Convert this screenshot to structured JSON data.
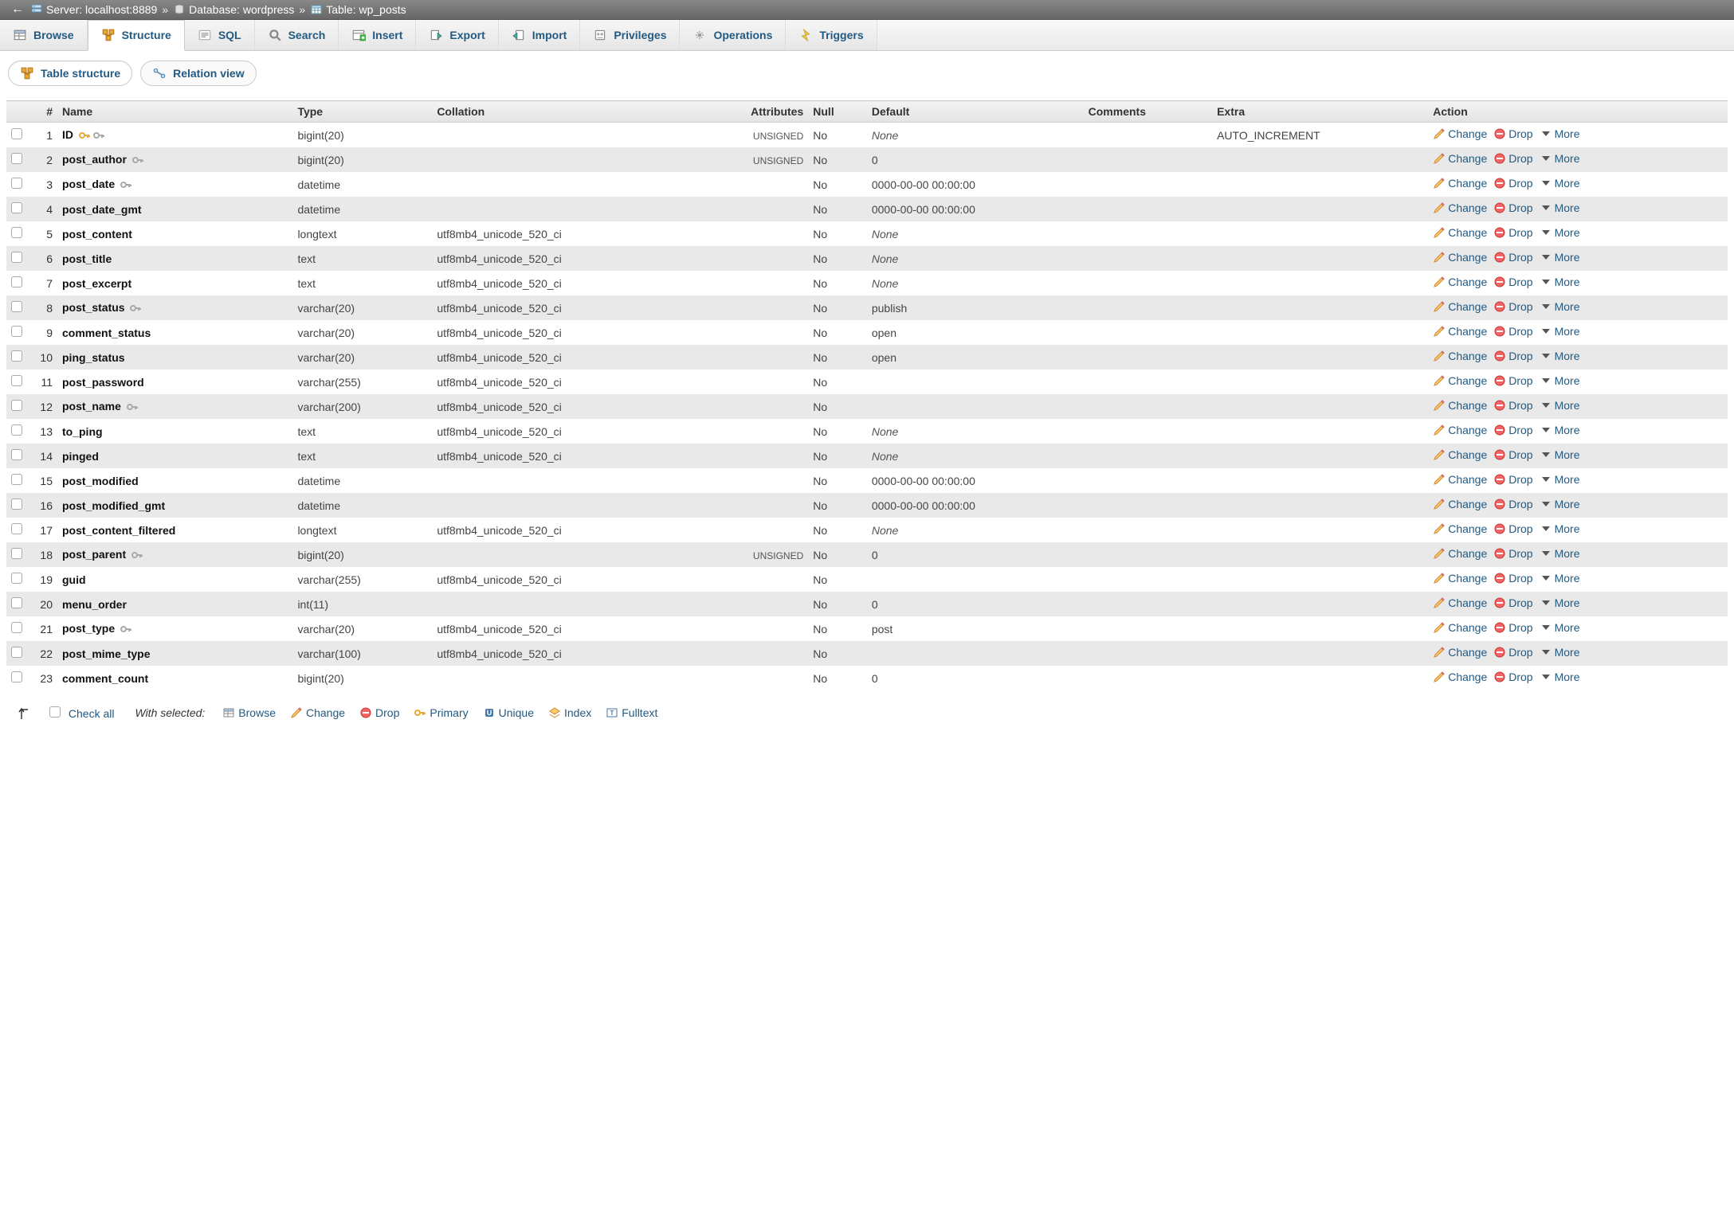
{
  "breadcrumb": {
    "server_label": "Server:",
    "server_value": "localhost:8889",
    "database_label": "Database:",
    "database_value": "wordpress",
    "table_label": "Table:",
    "table_value": "wp_posts"
  },
  "tabs": {
    "browse": "Browse",
    "structure": "Structure",
    "sql": "SQL",
    "search": "Search",
    "insert": "Insert",
    "export": "Export",
    "import": "Import",
    "privileges": "Privileges",
    "operations": "Operations",
    "triggers": "Triggers"
  },
  "subtabs": {
    "table_structure": "Table structure",
    "relation_view": "Relation view"
  },
  "thead": {
    "num": "#",
    "name": "Name",
    "type": "Type",
    "collation": "Collation",
    "attributes": "Attributes",
    "null": "Null",
    "default": "Default",
    "comments": "Comments",
    "extra": "Extra",
    "action": "Action"
  },
  "action_labels": {
    "change": "Change",
    "drop": "Drop",
    "more": "More"
  },
  "columns": [
    {
      "num": "1",
      "name": "ID",
      "primary": true,
      "index": true,
      "type": "bigint(20)",
      "collation": "",
      "attributes": "UNSIGNED",
      "null": "No",
      "default_text": "None",
      "default_italic": true,
      "comments": "",
      "extra": "AUTO_INCREMENT"
    },
    {
      "num": "2",
      "name": "post_author",
      "primary": false,
      "index": true,
      "type": "bigint(20)",
      "collation": "",
      "attributes": "UNSIGNED",
      "null": "No",
      "default_text": "0",
      "default_italic": false,
      "comments": "",
      "extra": ""
    },
    {
      "num": "3",
      "name": "post_date",
      "primary": false,
      "index": true,
      "type": "datetime",
      "collation": "",
      "attributes": "",
      "null": "No",
      "default_text": "0000-00-00 00:00:00",
      "default_italic": false,
      "comments": "",
      "extra": ""
    },
    {
      "num": "4",
      "name": "post_date_gmt",
      "primary": false,
      "index": false,
      "type": "datetime",
      "collation": "",
      "attributes": "",
      "null": "No",
      "default_text": "0000-00-00 00:00:00",
      "default_italic": false,
      "comments": "",
      "extra": ""
    },
    {
      "num": "5",
      "name": "post_content",
      "primary": false,
      "index": false,
      "type": "longtext",
      "collation": "utf8mb4_unicode_520_ci",
      "attributes": "",
      "null": "No",
      "default_text": "None",
      "default_italic": true,
      "comments": "",
      "extra": ""
    },
    {
      "num": "6",
      "name": "post_title",
      "primary": false,
      "index": false,
      "type": "text",
      "collation": "utf8mb4_unicode_520_ci",
      "attributes": "",
      "null": "No",
      "default_text": "None",
      "default_italic": true,
      "comments": "",
      "extra": ""
    },
    {
      "num": "7",
      "name": "post_excerpt",
      "primary": false,
      "index": false,
      "type": "text",
      "collation": "utf8mb4_unicode_520_ci",
      "attributes": "",
      "null": "No",
      "default_text": "None",
      "default_italic": true,
      "comments": "",
      "extra": ""
    },
    {
      "num": "8",
      "name": "post_status",
      "primary": false,
      "index": true,
      "type": "varchar(20)",
      "collation": "utf8mb4_unicode_520_ci",
      "attributes": "",
      "null": "No",
      "default_text": "publish",
      "default_italic": false,
      "comments": "",
      "extra": ""
    },
    {
      "num": "9",
      "name": "comment_status",
      "primary": false,
      "index": false,
      "type": "varchar(20)",
      "collation": "utf8mb4_unicode_520_ci",
      "attributes": "",
      "null": "No",
      "default_text": "open",
      "default_italic": false,
      "comments": "",
      "extra": ""
    },
    {
      "num": "10",
      "name": "ping_status",
      "primary": false,
      "index": false,
      "type": "varchar(20)",
      "collation": "utf8mb4_unicode_520_ci",
      "attributes": "",
      "null": "No",
      "default_text": "open",
      "default_italic": false,
      "comments": "",
      "extra": ""
    },
    {
      "num": "11",
      "name": "post_password",
      "primary": false,
      "index": false,
      "type": "varchar(255)",
      "collation": "utf8mb4_unicode_520_ci",
      "attributes": "",
      "null": "No",
      "default_text": "",
      "default_italic": false,
      "comments": "",
      "extra": ""
    },
    {
      "num": "12",
      "name": "post_name",
      "primary": false,
      "index": true,
      "type": "varchar(200)",
      "collation": "utf8mb4_unicode_520_ci",
      "attributes": "",
      "null": "No",
      "default_text": "",
      "default_italic": false,
      "comments": "",
      "extra": ""
    },
    {
      "num": "13",
      "name": "to_ping",
      "primary": false,
      "index": false,
      "type": "text",
      "collation": "utf8mb4_unicode_520_ci",
      "attributes": "",
      "null": "No",
      "default_text": "None",
      "default_italic": true,
      "comments": "",
      "extra": ""
    },
    {
      "num": "14",
      "name": "pinged",
      "primary": false,
      "index": false,
      "type": "text",
      "collation": "utf8mb4_unicode_520_ci",
      "attributes": "",
      "null": "No",
      "default_text": "None",
      "default_italic": true,
      "comments": "",
      "extra": ""
    },
    {
      "num": "15",
      "name": "post_modified",
      "primary": false,
      "index": false,
      "type": "datetime",
      "collation": "",
      "attributes": "",
      "null": "No",
      "default_text": "0000-00-00 00:00:00",
      "default_italic": false,
      "comments": "",
      "extra": ""
    },
    {
      "num": "16",
      "name": "post_modified_gmt",
      "primary": false,
      "index": false,
      "type": "datetime",
      "collation": "",
      "attributes": "",
      "null": "No",
      "default_text": "0000-00-00 00:00:00",
      "default_italic": false,
      "comments": "",
      "extra": ""
    },
    {
      "num": "17",
      "name": "post_content_filtered",
      "primary": false,
      "index": false,
      "type": "longtext",
      "collation": "utf8mb4_unicode_520_ci",
      "attributes": "",
      "null": "No",
      "default_text": "None",
      "default_italic": true,
      "comments": "",
      "extra": ""
    },
    {
      "num": "18",
      "name": "post_parent",
      "primary": false,
      "index": true,
      "type": "bigint(20)",
      "collation": "",
      "attributes": "UNSIGNED",
      "null": "No",
      "default_text": "0",
      "default_italic": false,
      "comments": "",
      "extra": ""
    },
    {
      "num": "19",
      "name": "guid",
      "primary": false,
      "index": false,
      "type": "varchar(255)",
      "collation": "utf8mb4_unicode_520_ci",
      "attributes": "",
      "null": "No",
      "default_text": "",
      "default_italic": false,
      "comments": "",
      "extra": ""
    },
    {
      "num": "20",
      "name": "menu_order",
      "primary": false,
      "index": false,
      "type": "int(11)",
      "collation": "",
      "attributes": "",
      "null": "No",
      "default_text": "0",
      "default_italic": false,
      "comments": "",
      "extra": ""
    },
    {
      "num": "21",
      "name": "post_type",
      "primary": false,
      "index": true,
      "type": "varchar(20)",
      "collation": "utf8mb4_unicode_520_ci",
      "attributes": "",
      "null": "No",
      "default_text": "post",
      "default_italic": false,
      "comments": "",
      "extra": ""
    },
    {
      "num": "22",
      "name": "post_mime_type",
      "primary": false,
      "index": false,
      "type": "varchar(100)",
      "collation": "utf8mb4_unicode_520_ci",
      "attributes": "",
      "null": "No",
      "default_text": "",
      "default_italic": false,
      "comments": "",
      "extra": ""
    },
    {
      "num": "23",
      "name": "comment_count",
      "primary": false,
      "index": false,
      "type": "bigint(20)",
      "collation": "",
      "attributes": "",
      "null": "No",
      "default_text": "0",
      "default_italic": false,
      "comments": "",
      "extra": ""
    }
  ],
  "footer": {
    "check_all": "Check all",
    "with_selected": "With selected:",
    "browse": "Browse",
    "change": "Change",
    "drop": "Drop",
    "primary": "Primary",
    "unique": "Unique",
    "index": "Index",
    "fulltext": "Fulltext"
  }
}
